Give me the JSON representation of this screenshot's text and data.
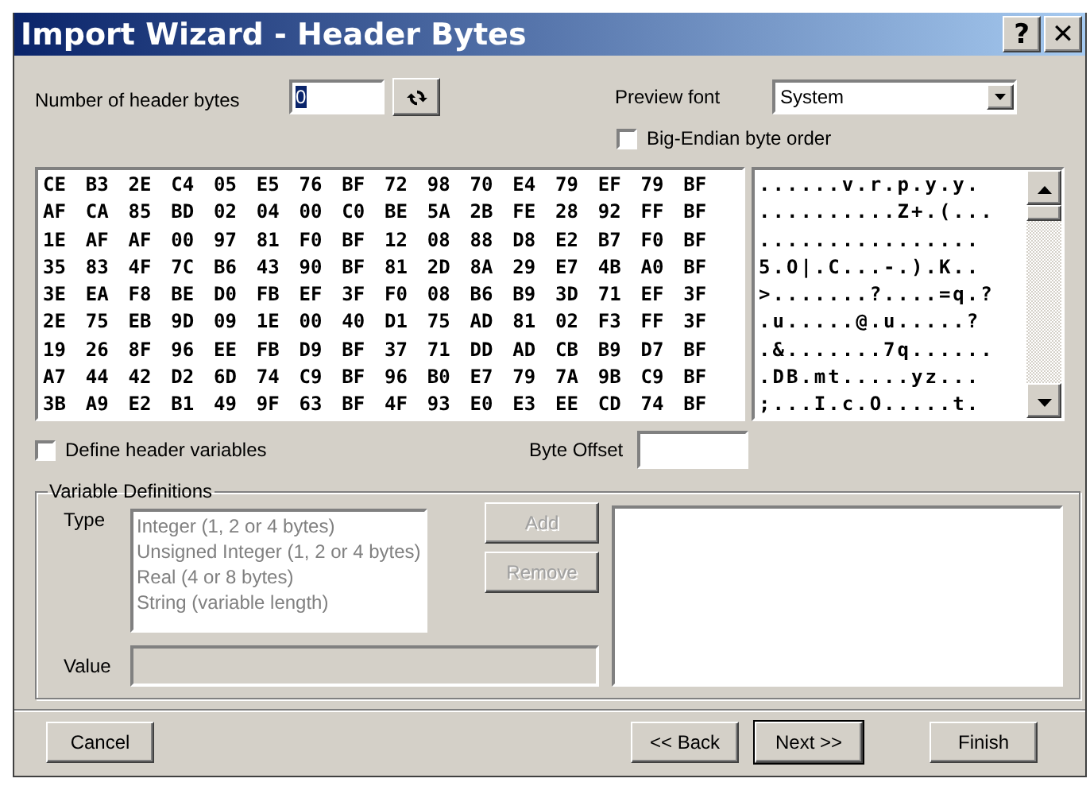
{
  "window": {
    "title": "Import Wizard - Header Bytes",
    "help_button": "?",
    "close_button": "✕"
  },
  "header_bytes": {
    "label": "Number of header bytes",
    "value": "0"
  },
  "preview_font": {
    "label": "Preview font",
    "value": "System"
  },
  "big_endian": {
    "label": "Big-Endian byte order",
    "checked": false
  },
  "hex_rows": [
    "CE B3 2E C4 05 E5 76 BF 72 98 70 E4 79 EF 79 BF",
    "AF CA 85 BD 02 04 00 C0 BE 5A 2B FE 28 92 FF BF",
    "1E AF AF 00 97 81 F0 BF 12 08 88 D8 E2 B7 F0 BF",
    "35 83 4F 7C B6 43 90 BF 81 2D 8A 29 E7 4B A0 BF",
    "3E EA F8 BE D0 FB EF 3F F0 08 B6 B9 3D 71 EF 3F",
    "2E 75 EB 9D 09 1E 00 40 D1 75 AD 81 02 F3 FF 3F",
    "19 26 8F 96 EE FB D9 BF 37 71 DD AD CB B9 D7 BF",
    "A7 44 42 D2 6D 74 C9 BF 96 B0 E7 79 7A 9B C9 BF",
    "3B A9 E2 B1 49 9F 63 BF 4F 93 E0 E3 EE CD 74 BF"
  ],
  "ascii_rows": [
    "......v.r.p.y.y.",
    "..........Z+.(...",
    "................",
    "5.O|.C...-.).K..",
    ">.......?....=q.?",
    ".u.....@.u.....?",
    ".&.......7q......",
    ".DB.mt.....yz...",
    ";...I.c.O.....t."
  ],
  "define_variables": {
    "label": "Define header variables",
    "checked": false
  },
  "byte_offset": {
    "label": "Byte Offset"
  },
  "variable_definitions": {
    "title": "Variable Definitions",
    "type_label": "Type",
    "types": [
      {
        "label": "Integer (1, 2 or 4 bytes)",
        "disabled": true
      },
      {
        "label": "Unsigned Integer (1, 2 or 4 bytes)",
        "disabled": true
      },
      {
        "label": "Real (4 or 8 bytes)",
        "disabled": true
      },
      {
        "label": "String (variable length)",
        "disabled": true
      }
    ],
    "add_button": {
      "label": "Add",
      "disabled": true
    },
    "remove_button": {
      "label": "Remove",
      "disabled": true
    },
    "value_label": "Value",
    "value_disabled": true
  },
  "buttons": [
    {
      "label": "Cancel",
      "kind": "left",
      "default": false
    },
    {
      "label": "<< Back",
      "kind": "right",
      "default": false
    },
    {
      "label": "Next >>",
      "kind": "right",
      "default": true
    },
    {
      "label": "Finish",
      "kind": "far",
      "default": false
    }
  ]
}
